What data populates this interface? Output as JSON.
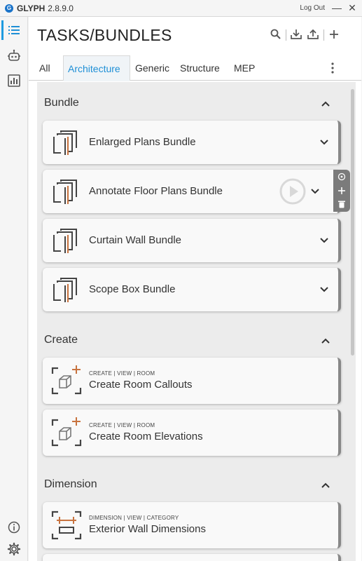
{
  "titlebar": {
    "app_name": "GLYPH",
    "version": "2.8.9.0",
    "logout_label": "Log Out",
    "minimize_glyph": "—",
    "close_glyph": "✕",
    "logo_letter": "G"
  },
  "header": {
    "title": "TASKS/BUNDLES"
  },
  "tabs": [
    {
      "label": "All",
      "active": false
    },
    {
      "label": "Architecture",
      "active": true
    },
    {
      "label": "Generic",
      "active": false
    },
    {
      "label": "Structure",
      "active": false
    },
    {
      "label": "MEP",
      "active": false
    }
  ],
  "sections": {
    "bundle": {
      "title": "Bundle",
      "items": [
        {
          "title": "Enlarged Plans Bundle"
        },
        {
          "title": "Annotate Floor Plans Bundle"
        },
        {
          "title": "Curtain Wall Bundle"
        },
        {
          "title": "Scope Box Bundle"
        }
      ]
    },
    "create": {
      "title": "Create",
      "items": [
        {
          "tags": "CREATE | VIEW | ROOM",
          "title": "Create Room Callouts"
        },
        {
          "tags": "CREATE | VIEW | ROOM",
          "title": "Create Room Elevations"
        }
      ]
    },
    "dimension": {
      "title": "Dimension",
      "items": [
        {
          "tags": "DIMENSION | VIEW | CATEGORY",
          "title": "Exterior Wall Dimensions"
        }
      ]
    }
  },
  "colors": {
    "accent": "#1e8fd6",
    "icon_orange": "#c8733f",
    "card_edge": "#888888"
  },
  "icons": {
    "rail": [
      "list-icon",
      "robot-icon",
      "chart-icon",
      "info-icon",
      "gear-icon"
    ],
    "header": [
      "search-icon",
      "download-icon",
      "upload-icon",
      "plus-icon"
    ]
  }
}
